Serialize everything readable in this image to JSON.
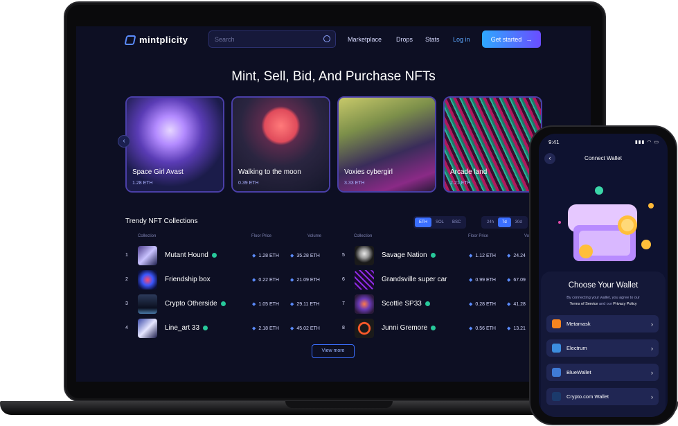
{
  "app": {
    "brand": "mintplicity"
  },
  "nav": {
    "search_placeholder": "Search",
    "links": [
      "Marketplace",
      "Drops",
      "Stats"
    ],
    "login": "Log in",
    "get_started": "Get started",
    "arrow": "→"
  },
  "hero": {
    "title": "Mint, Sell, Bid, And Purchase NFTs"
  },
  "carousel": {
    "prev": "‹",
    "cards": [
      {
        "name": "Space Girl Avast",
        "price": "1.28 ETH"
      },
      {
        "name": "Walking to the moon",
        "price": "0.39 ETH"
      },
      {
        "name": "Voxies cybergirl",
        "price": "3.33 ETH"
      },
      {
        "name": "Arcade land",
        "price": "2.21 ETH"
      }
    ]
  },
  "collections": {
    "title": "Trendy NFT Collections",
    "chains": [
      "ETH",
      "SOL",
      "BSC"
    ],
    "periods": [
      "24h",
      "7d",
      "30d"
    ],
    "active_chain": "ETH",
    "active_period": "7d",
    "headers": {
      "collection": "Collection",
      "floor": "Floor Price",
      "volume": "Volume",
      "volume_cut": "Vo"
    },
    "rows": [
      {
        "rank": "1",
        "name": "Mutant Hound",
        "floor": "1.28 ETH",
        "volume": "35.28 ETH",
        "verified": true
      },
      {
        "rank": "2",
        "name": "Friendship box",
        "floor": "0.22 ETH",
        "volume": "21.09 ETH",
        "verified": false
      },
      {
        "rank": "3",
        "name": "Crypto Otherside",
        "floor": "1.05 ETH",
        "volume": "29.11 ETH",
        "verified": true
      },
      {
        "rank": "4",
        "name": "Line_art 33",
        "floor": "2.18 ETH",
        "volume": "45.02 ETH",
        "verified": true
      },
      {
        "rank": "5",
        "name": "Savage Nation",
        "floor": "1.12 ETH",
        "volume": "24.24",
        "verified": true
      },
      {
        "rank": "6",
        "name": "Grandsville super car",
        "floor": "0.99 ETH",
        "volume": "67.09",
        "verified": false
      },
      {
        "rank": "7",
        "name": "Scottie SP33",
        "floor": "0.28 ETH",
        "volume": "41.28",
        "verified": true
      },
      {
        "rank": "8",
        "name": "Junni Gremore",
        "floor": "0.56 ETH",
        "volume": "13.21",
        "verified": true
      }
    ],
    "view_more": "View more"
  },
  "phone": {
    "time": "9:41",
    "status": "▮▮▮ ◠ ▭",
    "back": "‹",
    "title": "Connect Wallet",
    "choose_title": "Choose Your Wallet",
    "choose_sub_1": "By connecting your wallet, you agree to our",
    "terms": "Terms of Service",
    "and": "and our",
    "privacy": "Privacy Policy",
    "wallets": [
      {
        "name": "Metamask",
        "color": "#f5841f"
      },
      {
        "name": "Electrum",
        "color": "#3c8dde"
      },
      {
        "name": "BlueWallet",
        "color": "#3f7bd6"
      },
      {
        "name": "Crypto.com Wallet",
        "color": "#1b3a6b"
      }
    ],
    "chevron": "›"
  },
  "colors": {
    "accent": "#3b6fff",
    "background": "#0d0f23",
    "verified": "#27c99a"
  }
}
